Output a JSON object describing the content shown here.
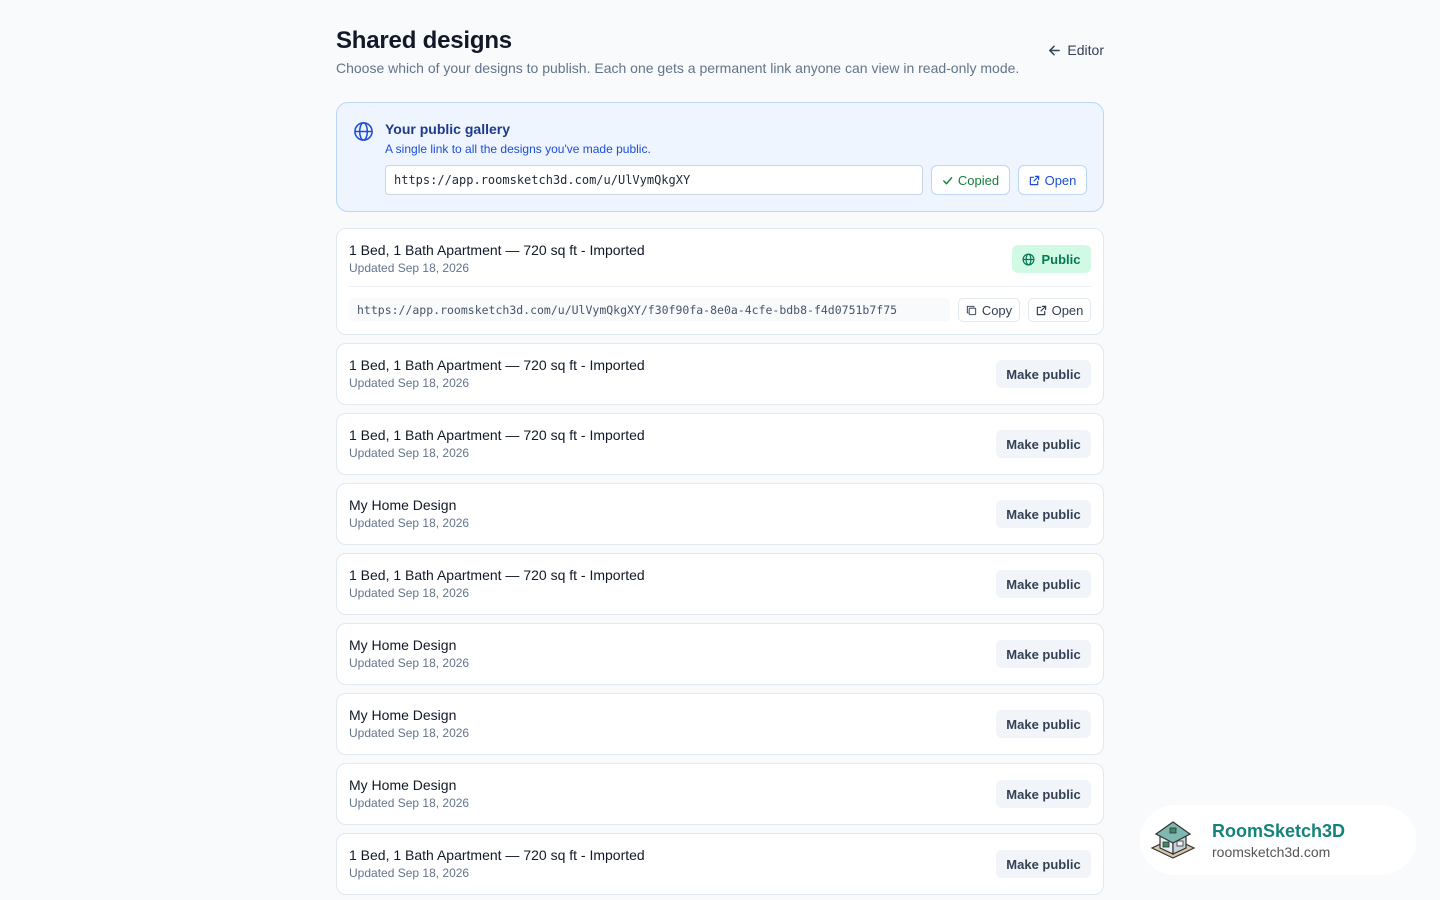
{
  "header": {
    "title": "Shared designs",
    "subtitle": "Choose which of your designs to publish. Each one gets a permanent link anyone can view in read-only mode.",
    "editor_link": "Editor"
  },
  "gallery": {
    "title": "Your public gallery",
    "description": "A single link to all the designs you've made public.",
    "url": "https://app.roomsketch3d.com/u/UlVymQkgXY",
    "copied_label": "Copied",
    "open_label": "Open"
  },
  "designs": [
    {
      "name": "1 Bed, 1 Bath Apartment — 720 sq ft - Imported",
      "updated": "Updated Sep 18, 2026",
      "status": "Public",
      "share_url": "https://app.roomsketch3d.com/u/UlVymQkgXY/f30f90fa-8e0a-4cfe-bdb8-f4d0751b7f75",
      "copy_label": "Copy",
      "open_label": "Open"
    },
    {
      "name": "1 Bed, 1 Bath Apartment — 720 sq ft - Imported",
      "updated": "Updated Sep 18, 2026",
      "action": "Make public"
    },
    {
      "name": "1 Bed, 1 Bath Apartment — 720 sq ft - Imported",
      "updated": "Updated Sep 18, 2026",
      "action": "Make public"
    },
    {
      "name": "My Home Design",
      "updated": "Updated Sep 18, 2026",
      "action": "Make public"
    },
    {
      "name": "1 Bed, 1 Bath Apartment — 720 sq ft - Imported",
      "updated": "Updated Sep 18, 2026",
      "action": "Make public"
    },
    {
      "name": "My Home Design",
      "updated": "Updated Sep 18, 2026",
      "action": "Make public"
    },
    {
      "name": "My Home Design",
      "updated": "Updated Sep 18, 2026",
      "action": "Make public"
    },
    {
      "name": "My Home Design",
      "updated": "Updated Sep 18, 2026",
      "action": "Make public"
    },
    {
      "name": "1 Bed, 1 Bath Apartment — 720 sq ft - Imported",
      "updated": "Updated Sep 18, 2026",
      "action": "Make public"
    }
  ],
  "brand": {
    "name": "RoomSketch3D",
    "url": "roomsketch3d.com"
  },
  "colors": {
    "accent_blue": "#1d4ed8",
    "public_green": "#047857",
    "brand_teal": "#14837a"
  },
  "icons": {
    "editor_link": "arrow-left-icon",
    "gallery": "globe-icon",
    "copied": "check-icon",
    "open": "external-link-icon",
    "copy": "copy-icon",
    "public": "globe-icon"
  }
}
